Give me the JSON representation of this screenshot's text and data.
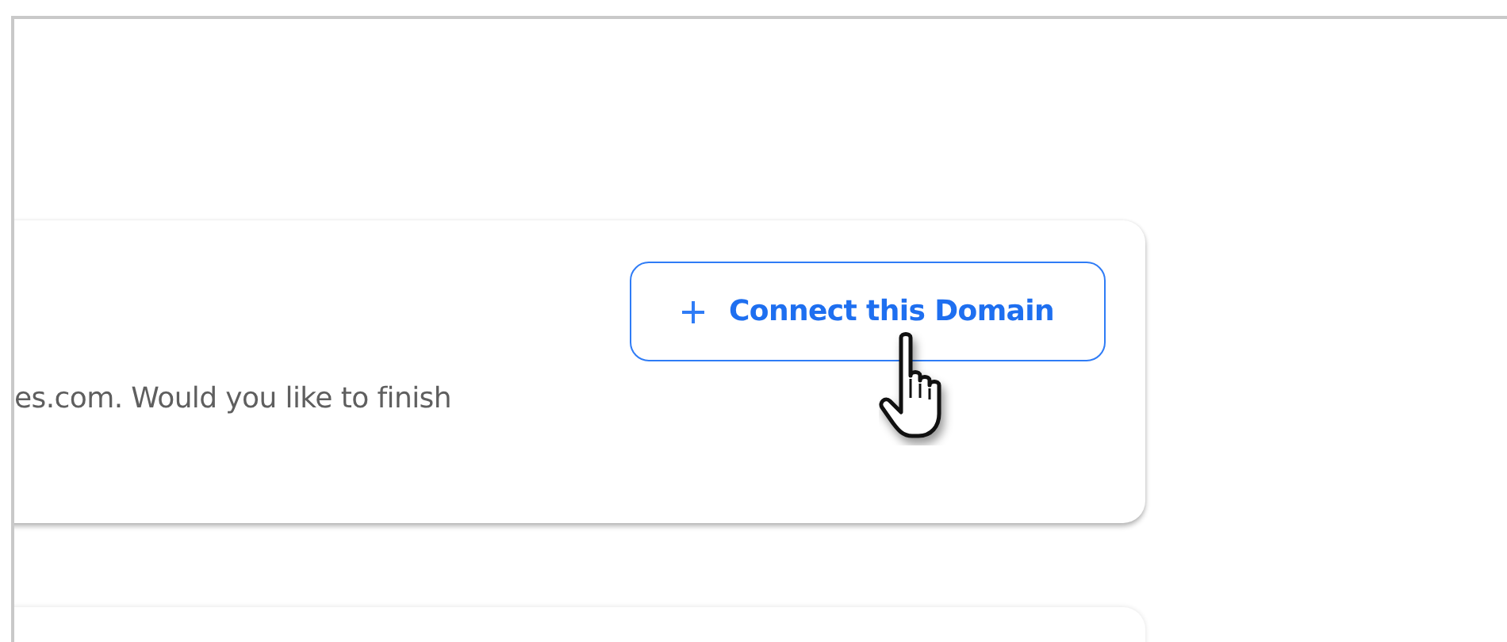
{
  "card": {
    "description": "es.com. Would you like to finish",
    "button": {
      "label": "Connect this Domain"
    }
  }
}
